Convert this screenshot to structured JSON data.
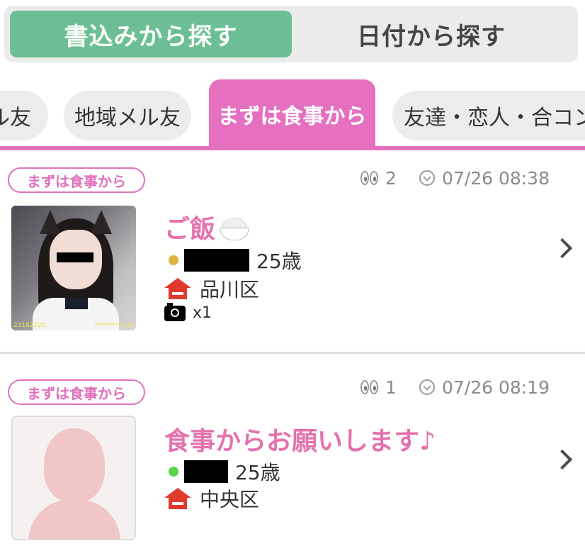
{
  "segment": {
    "active_label": "書込みから探す",
    "inactive_label": "日付から探す"
  },
  "tabs": {
    "items": [
      {
        "label": "ル友"
      },
      {
        "label": "地域メル友"
      },
      {
        "label": "まずは食事から",
        "active": true
      },
      {
        "label": "友達・恋人・合コン"
      }
    ]
  },
  "posts": [
    {
      "category": "まずは食事から",
      "views": "2",
      "datetime": "07/26 08:38",
      "title": "ご飯",
      "title_emoji": "rice-bowl",
      "status_color": "#e0b340",
      "age": "25歳",
      "area": "品川区",
      "photos": "x1",
      "photo_tag_left": "23182220",
      "photo_tag_right": "h******.com"
    },
    {
      "category": "まずは食事から",
      "views": "1",
      "datetime": "07/26 08:19",
      "title": "食事からお願いします♪",
      "status_color": "#5ad64b",
      "age": "25歳",
      "area": "中央区"
    }
  ],
  "colors": {
    "accent_pink": "#e570bf",
    "green": "#6cbf94",
    "house_red": "#e03a2e"
  }
}
